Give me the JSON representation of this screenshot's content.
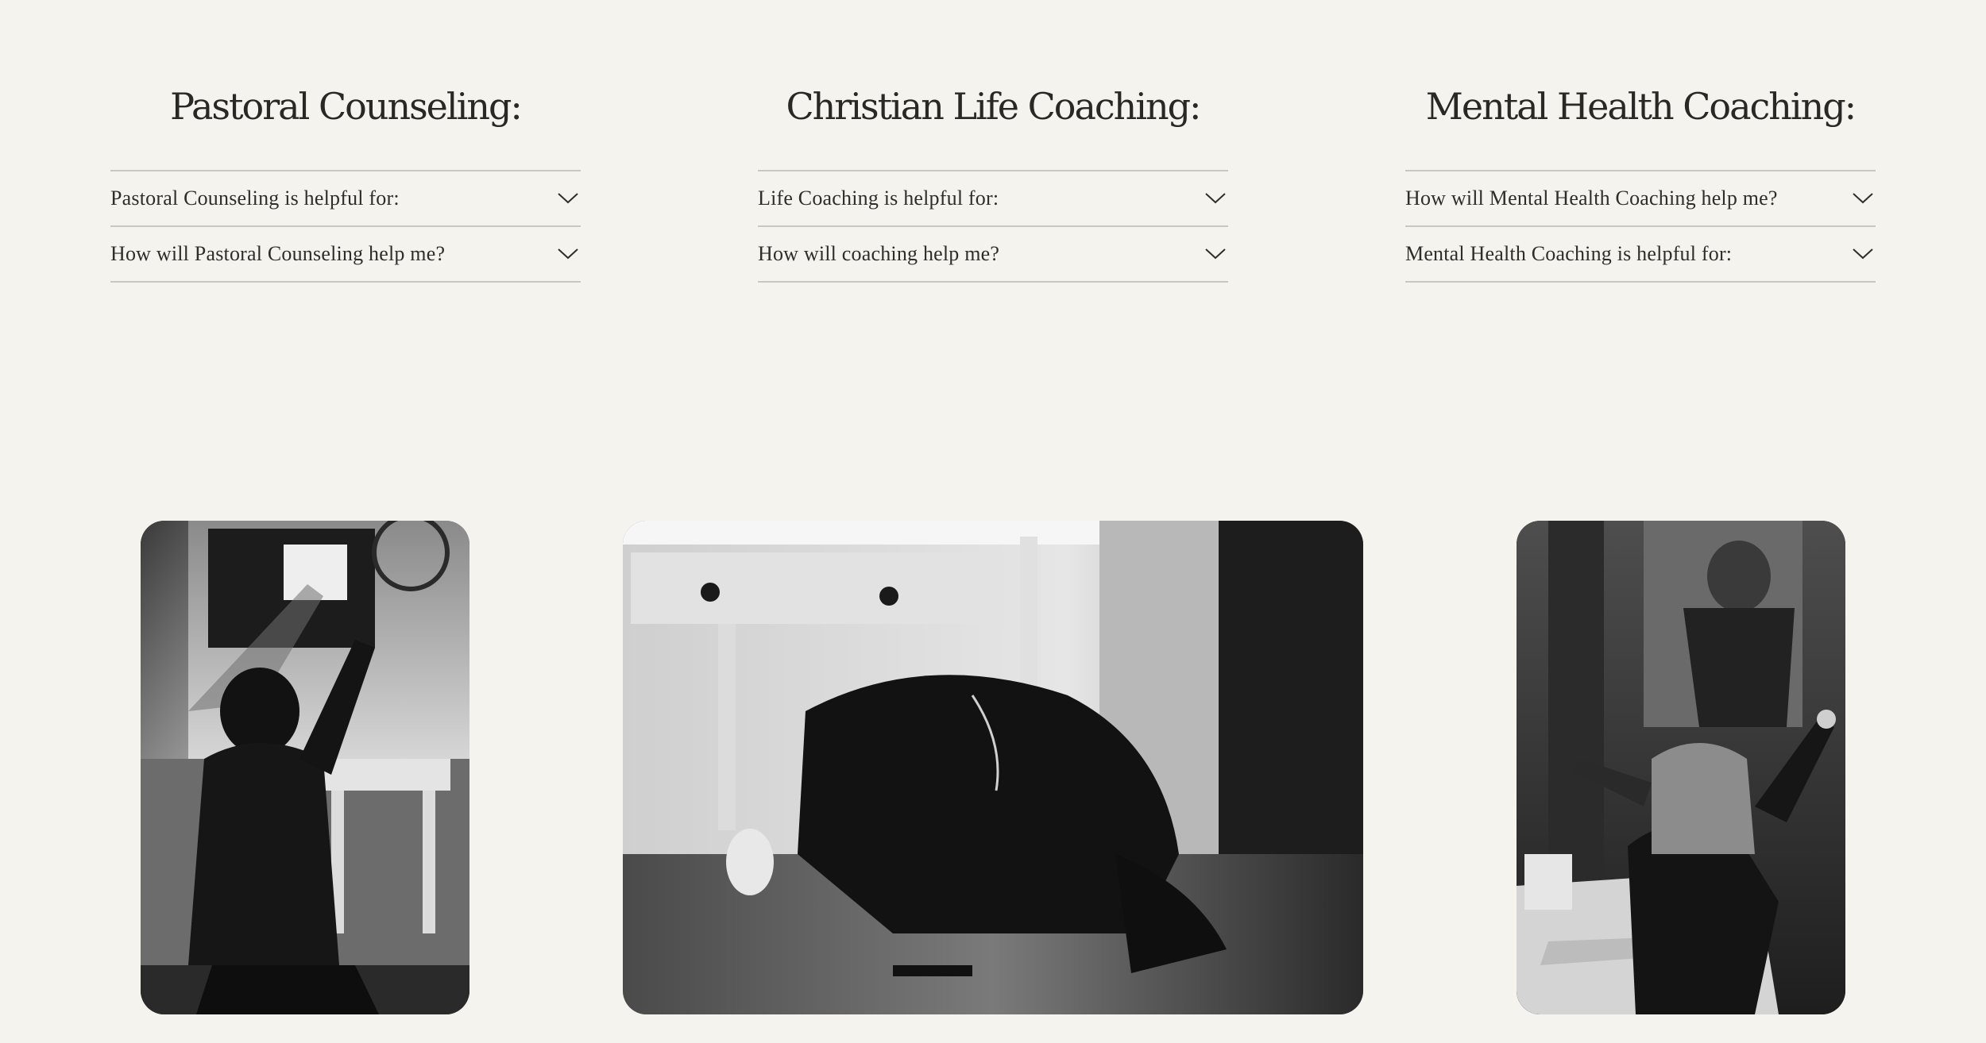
{
  "services": [
    {
      "title": "Pastoral Counseling:",
      "items": [
        "Pastoral Counseling is helpful for:",
        "How will Pastoral Counseling help me?"
      ]
    },
    {
      "title": "Christian Life Coaching:",
      "items": [
        "Life Coaching is helpful for:",
        "How will coaching help me?"
      ]
    },
    {
      "title": "Mental Health Coaching:",
      "items": [
        "How will Mental Health Coaching help me?",
        "Mental Health Coaching is helpful for:"
      ]
    }
  ],
  "icons": {
    "expand": "chevron-down-icon"
  },
  "colors": {
    "background": "#f4f3ee",
    "divider": "#c9c7c1",
    "text": "#262421"
  }
}
